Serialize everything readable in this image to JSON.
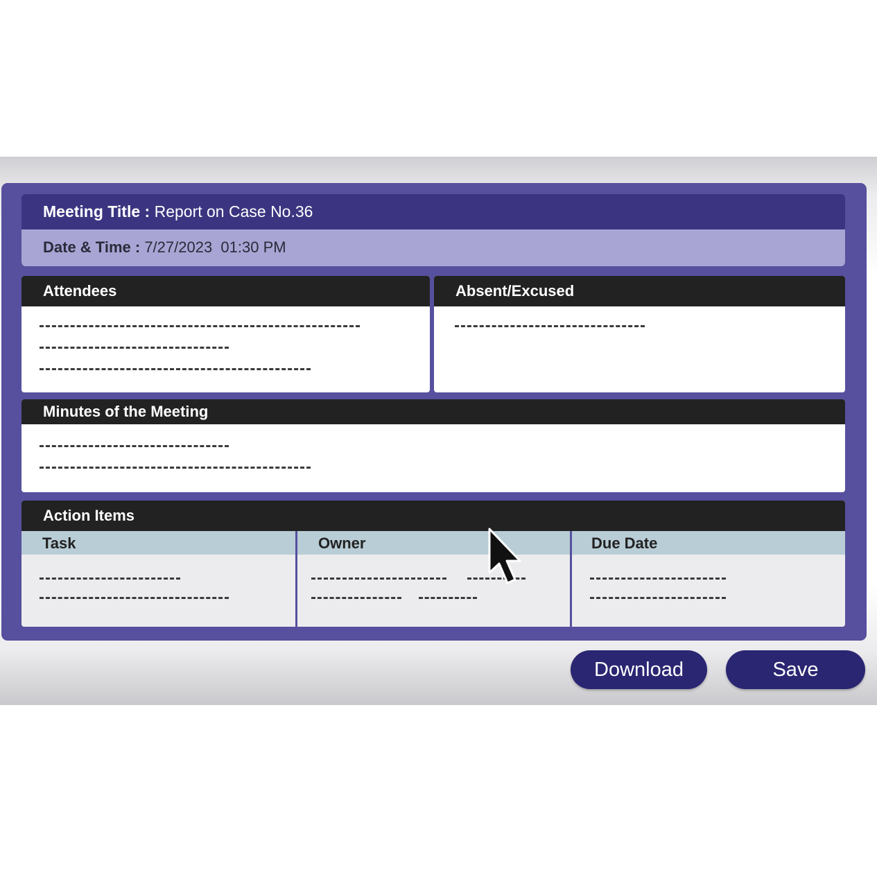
{
  "meeting": {
    "title_label": "Meeting Title :",
    "title_value": "Report on Case No.36",
    "datetime_label": "Date & Time :",
    "datetime_value": "7/27/2023  01:30 PM"
  },
  "attendees": {
    "header": "Attendees"
  },
  "absent": {
    "header": "Absent/Excused"
  },
  "minutes": {
    "header": "Minutes of the Meeting"
  },
  "action_items": {
    "header": "Action Items",
    "columns": [
      "Task",
      "Owner",
      "Due Date"
    ]
  },
  "buttons": {
    "download": "Download",
    "save": "Save"
  },
  "colors": {
    "frame": "#56509e",
    "title_bar": "#3b3581",
    "date_bar": "#a8a5d4",
    "section_header": "#222222",
    "column_header": "#b9cdd6",
    "button": "#2a2672"
  },
  "icons": {
    "pointer": "mouse-cursor-icon"
  }
}
